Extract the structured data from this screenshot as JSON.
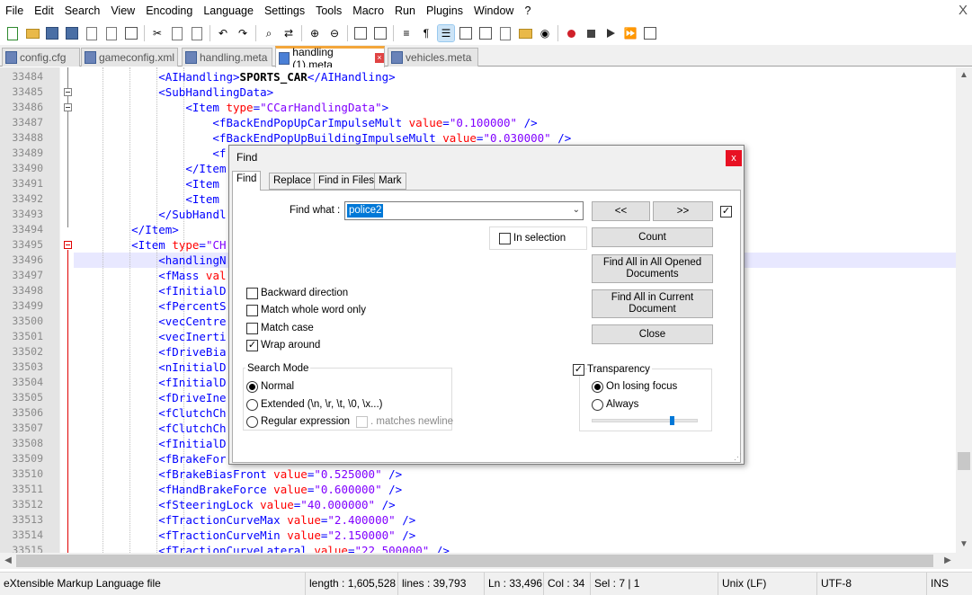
{
  "menu": [
    "File",
    "Edit",
    "Search",
    "View",
    "Encoding",
    "Language",
    "Settings",
    "Tools",
    "Macro",
    "Run",
    "Plugins",
    "Window",
    "?"
  ],
  "window_close": "X",
  "tabs": [
    {
      "label": "config.cfg"
    },
    {
      "label": "gameconfig.xml"
    },
    {
      "label": "handling.meta"
    },
    {
      "label": "handling (1).meta"
    },
    {
      "label": "vehicles.meta"
    }
  ],
  "active_tab_index": 3,
  "editor": {
    "line_numbers": [
      "33484",
      "33485",
      "33486",
      "33487",
      "33488",
      "33489",
      "33490",
      "33491",
      "33492",
      "33493",
      "33494",
      "33495",
      "33496",
      "33497",
      "33498",
      "33499",
      "33500",
      "33501",
      "33502",
      "33503",
      "33504",
      "33505",
      "33506",
      "33507",
      "33508",
      "33509",
      "33510",
      "33511",
      "33512",
      "33513",
      "33514",
      "33515"
    ],
    "lines": [
      {
        "indent": 3,
        "parts": [
          [
            "tag",
            "<AIHandling>"
          ],
          [
            "txt",
            "SPORTS_CAR"
          ],
          [
            "tag",
            "</AIHandling>"
          ]
        ]
      },
      {
        "indent": 3,
        "parts": [
          [
            "tag",
            "<SubHandlingData>"
          ]
        ]
      },
      {
        "indent": 4,
        "parts": [
          [
            "tag",
            "<Item "
          ],
          [
            "attr",
            "type"
          ],
          [
            "tag",
            "="
          ],
          [
            "val",
            "\"CCarHandlingData\""
          ],
          [
            "tag",
            ">"
          ]
        ]
      },
      {
        "indent": 5,
        "parts": [
          [
            "tag",
            "<fBackEndPopUpCarImpulseMult "
          ],
          [
            "attr",
            "value"
          ],
          [
            "tag",
            "="
          ],
          [
            "val",
            "\"0.100000\""
          ],
          [
            "tag",
            " />"
          ]
        ]
      },
      {
        "indent": 5,
        "parts": [
          [
            "tag",
            "<fBackEndPopUpBuildingImpulseMult "
          ],
          [
            "attr",
            "value"
          ],
          [
            "tag",
            "="
          ],
          [
            "val",
            "\"0.030000\""
          ],
          [
            "tag",
            " />"
          ]
        ]
      },
      {
        "indent": 5,
        "parts": [
          [
            "tag",
            "<f"
          ]
        ]
      },
      {
        "indent": 4,
        "parts": [
          [
            "tag",
            "</Item"
          ]
        ]
      },
      {
        "indent": 4,
        "parts": [
          [
            "tag",
            "<Item"
          ]
        ]
      },
      {
        "indent": 4,
        "parts": [
          [
            "tag",
            "<Item"
          ]
        ]
      },
      {
        "indent": 3,
        "parts": [
          [
            "tag",
            "</SubHandl"
          ]
        ]
      },
      {
        "indent": 2,
        "parts": [
          [
            "tag",
            "</Item>"
          ]
        ]
      },
      {
        "indent": 2,
        "parts": [
          [
            "tag",
            "<Item "
          ],
          [
            "attr",
            "type"
          ],
          [
            "tag",
            "="
          ],
          [
            "val",
            "\"CH"
          ]
        ]
      },
      {
        "indent": 3,
        "parts": [
          [
            "tag",
            "<handlingN"
          ]
        ]
      },
      {
        "indent": 3,
        "parts": [
          [
            "tag",
            "<fMass "
          ],
          [
            "attr",
            "val"
          ]
        ]
      },
      {
        "indent": 3,
        "parts": [
          [
            "tag",
            "<fInitialD"
          ]
        ]
      },
      {
        "indent": 3,
        "parts": [
          [
            "tag",
            "<fPercentS"
          ]
        ]
      },
      {
        "indent": 3,
        "parts": [
          [
            "tag",
            "<vecCentre"
          ]
        ]
      },
      {
        "indent": 3,
        "parts": [
          [
            "tag",
            "<vecInerti"
          ]
        ]
      },
      {
        "indent": 3,
        "parts": [
          [
            "tag",
            "<fDriveBia"
          ]
        ]
      },
      {
        "indent": 3,
        "parts": [
          [
            "tag",
            "<nInitialD"
          ]
        ]
      },
      {
        "indent": 3,
        "parts": [
          [
            "tag",
            "<fInitialD"
          ]
        ]
      },
      {
        "indent": 3,
        "parts": [
          [
            "tag",
            "<fDriveIne"
          ]
        ]
      },
      {
        "indent": 3,
        "parts": [
          [
            "tag",
            "<fClutchCh"
          ]
        ]
      },
      {
        "indent": 3,
        "parts": [
          [
            "tag",
            "<fClutchCh"
          ]
        ]
      },
      {
        "indent": 3,
        "parts": [
          [
            "tag",
            "<fInitialD"
          ]
        ]
      },
      {
        "indent": 3,
        "parts": [
          [
            "tag",
            "<fBrakeFor"
          ]
        ]
      },
      {
        "indent": 3,
        "parts": [
          [
            "tag",
            "<fBrakeBiasFront "
          ],
          [
            "attr",
            "value"
          ],
          [
            "tag",
            "="
          ],
          [
            "val",
            "\"0.525000\""
          ],
          [
            "tag",
            " />"
          ]
        ]
      },
      {
        "indent": 3,
        "parts": [
          [
            "tag",
            "<fHandBrakeForce "
          ],
          [
            "attr",
            "value"
          ],
          [
            "tag",
            "="
          ],
          [
            "val",
            "\"0.600000\""
          ],
          [
            "tag",
            " />"
          ]
        ]
      },
      {
        "indent": 3,
        "parts": [
          [
            "tag",
            "<fSteeringLock "
          ],
          [
            "attr",
            "value"
          ],
          [
            "tag",
            "="
          ],
          [
            "val",
            "\"40.000000\""
          ],
          [
            "tag",
            " />"
          ]
        ]
      },
      {
        "indent": 3,
        "parts": [
          [
            "tag",
            "<fTractionCurveMax "
          ],
          [
            "attr",
            "value"
          ],
          [
            "tag",
            "="
          ],
          [
            "val",
            "\"2.400000\""
          ],
          [
            "tag",
            " />"
          ]
        ]
      },
      {
        "indent": 3,
        "parts": [
          [
            "tag",
            "<fTractionCurveMin "
          ],
          [
            "attr",
            "value"
          ],
          [
            "tag",
            "="
          ],
          [
            "val",
            "\"2.150000\""
          ],
          [
            "tag",
            " />"
          ]
        ]
      },
      {
        "indent": 3,
        "parts": [
          [
            "tag",
            "<fTractionCurveLateral "
          ],
          [
            "attr",
            "value"
          ],
          [
            "tag",
            "="
          ],
          [
            "val",
            "\"22.500000\""
          ],
          [
            "tag",
            " />"
          ]
        ]
      }
    ],
    "current_line_index": 12
  },
  "find_dialog": {
    "title": "Find",
    "close": "x",
    "tabs": [
      "Find",
      "Replace",
      "Find in Files",
      "Mark"
    ],
    "find_what_label": "Find what :",
    "find_what_value": "police2",
    "prev_button": "<<",
    "next_button": ">>",
    "in_selection_label": "In selection",
    "count_button": "Count",
    "find_all_opened_button": "Find All in All Opened Documents",
    "find_all_current_button": "Find All in Current Document",
    "close_button": "Close",
    "backward_label": "Backward direction",
    "whole_word_label": "Match whole word only",
    "match_case_label": "Match case",
    "wrap_around_label": "Wrap around",
    "search_mode_title": "Search Mode",
    "mode_normal": "Normal",
    "mode_extended": "Extended (\\n, \\r, \\t, \\0, \\x...)",
    "mode_regex": "Regular expression",
    "matches_newline": ". matches newline",
    "transparency_label": "Transparency",
    "on_losing_focus": "On losing focus",
    "always": "Always",
    "checks": {
      "backward": false,
      "whole_word": false,
      "match_case": false,
      "wrap_around": true,
      "in_selection": false,
      "transparency": true,
      "search_checkbox": true,
      "matches_newline": false
    },
    "selected_mode": "normal",
    "selected_transparency": "on_losing_focus",
    "transparency_level": 0.75
  },
  "status": {
    "file_type": "eXtensible Markup Language file",
    "length": "length : 1,605,528",
    "lines": "lines : 39,793",
    "ln": "Ln : 33,496",
    "col": "Col : 34",
    "sel": "Sel : 7 | 1",
    "eol": "Unix (LF)",
    "encoding": "UTF-8",
    "mode": "INS"
  },
  "colors": {
    "tag": "#0000ff",
    "attr": "#ff0000",
    "value": "#8000ff",
    "active_tab_accent": "#f3a63b",
    "selection": "#0078d7"
  }
}
